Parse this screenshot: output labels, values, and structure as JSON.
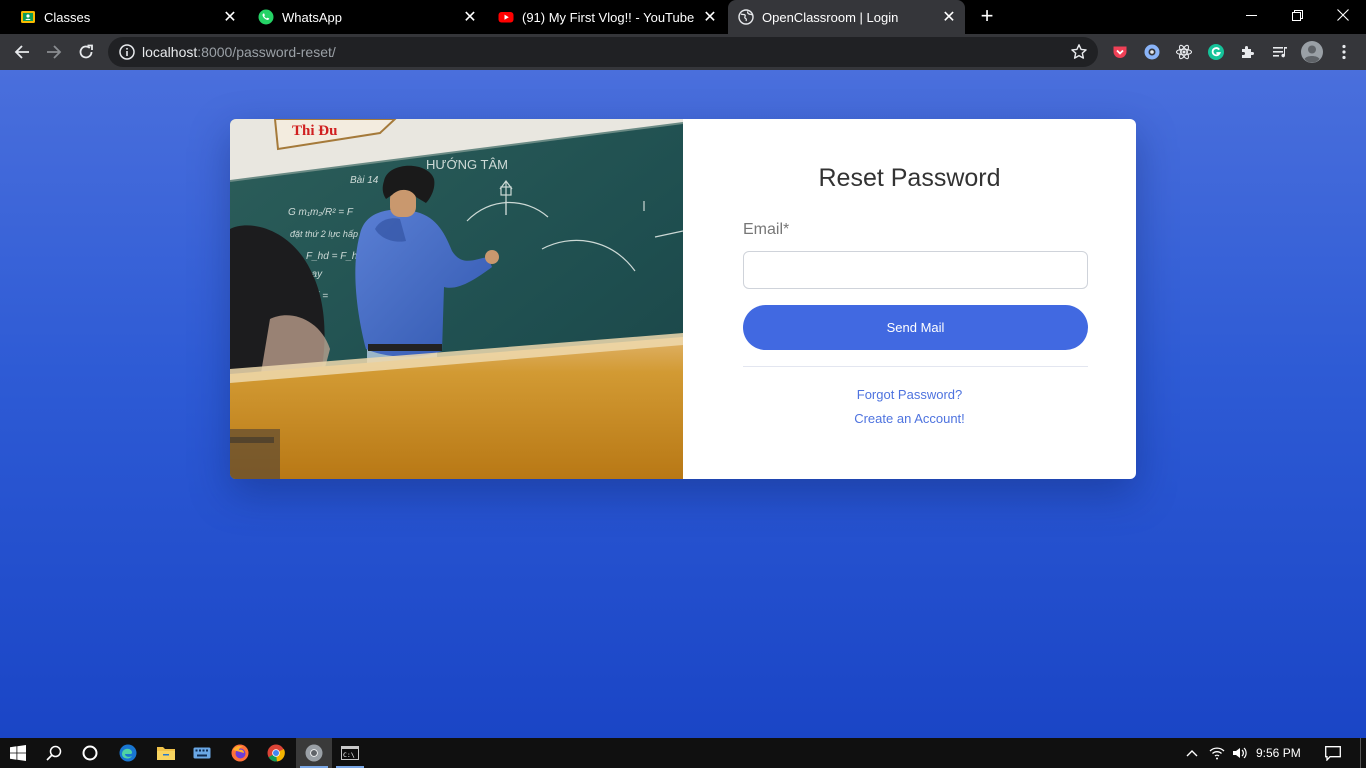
{
  "browser": {
    "tabs": [
      {
        "title": "Classes",
        "favicon": "google-classroom-icon",
        "active": false
      },
      {
        "title": "WhatsApp",
        "favicon": "whatsapp-icon",
        "active": false
      },
      {
        "title": "(91) My First Vlog!! - YouTube",
        "favicon": "youtube-icon",
        "active": false
      },
      {
        "title": "OpenClassroom | Login",
        "favicon": "globe-icon",
        "active": true
      }
    ],
    "url_host": "localhost",
    "url_path": ":8000/password-reset/",
    "extensions": [
      "pocket-icon",
      "extension-circle-icon",
      "react-devtools-icon",
      "grammarly-icon",
      "puzzle-icon",
      "media-controls-icon",
      "profile-avatar-icon",
      "more-menu-icon"
    ]
  },
  "page": {
    "heading": "Reset Password",
    "email_label": "Email*",
    "email_value": "",
    "submit_label": "Send Mail",
    "forgot_link": "Forgot Password?",
    "create_link": "Create an Account!",
    "image_subject": "classroom-teacher-blackboard-photo",
    "accent_color": "#4169e1"
  },
  "taskbar": {
    "apps": [
      "windows-start-icon",
      "search-icon",
      "cortana-icon",
      "edge-icon",
      "file-explorer-icon",
      "keyboard-icon",
      "firefox-icon",
      "chrome-icon",
      "chrome-active-icon",
      "terminal-icon"
    ],
    "time": "9:56 PM"
  }
}
